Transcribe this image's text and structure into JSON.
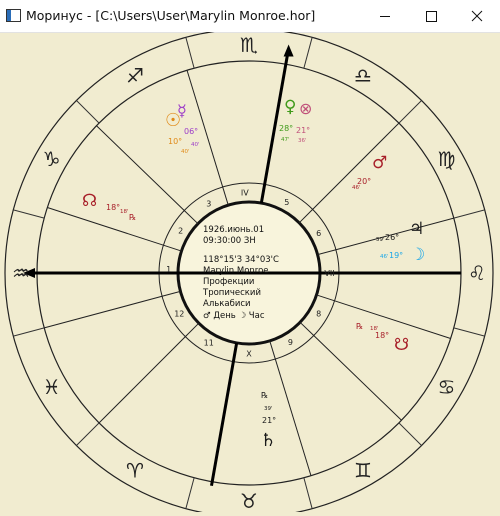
{
  "window": {
    "title": "Моринус - [C:\\Users\\User\\Marylin Monroe.hor]"
  },
  "chart": {
    "center_info": {
      "date": "1926.июнь.01",
      "time": "09:30:00 ЗН",
      "coords": "118°15'З  34°03'С",
      "name": "Marylin Monroe",
      "mode": "Профекции",
      "zodiac": "Тропический",
      "house_system": "Алькабиси",
      "day_ruler": "♂ День ☽ Час"
    },
    "signs": [
      {
        "name": "leo-sign-icon",
        "glyph": "♌"
      },
      {
        "name": "virgo-sign-icon",
        "glyph": "♍"
      },
      {
        "name": "libra-sign-icon",
        "glyph": "♎"
      },
      {
        "name": "scorpio-sign-icon",
        "glyph": "♏"
      },
      {
        "name": "sagittarius-sign-icon",
        "glyph": "♐"
      },
      {
        "name": "capricorn-sign-icon",
        "glyph": "♑"
      },
      {
        "name": "aquarius-sign-icon",
        "glyph": "♒"
      },
      {
        "name": "pisces-sign-icon",
        "glyph": "♓"
      },
      {
        "name": "aries-sign-icon",
        "glyph": "♈"
      },
      {
        "name": "taurus-sign-icon",
        "glyph": "♉"
      },
      {
        "name": "gemini-sign-icon",
        "glyph": "♊"
      },
      {
        "name": "cancer-sign-icon",
        "glyph": "♋"
      }
    ],
    "house_numbers": [
      {
        "name": "house-1",
        "label": "1"
      },
      {
        "name": "house-2",
        "label": "2"
      },
      {
        "name": "house-3",
        "label": "3"
      },
      {
        "name": "house-4",
        "label": "IV"
      },
      {
        "name": "house-5",
        "label": "5"
      },
      {
        "name": "house-6",
        "label": "6"
      },
      {
        "name": "house-7",
        "label": "VII"
      },
      {
        "name": "house-8",
        "label": "8"
      },
      {
        "name": "house-9",
        "label": "9"
      },
      {
        "name": "house-10",
        "label": "X"
      },
      {
        "name": "house-11",
        "label": "11"
      },
      {
        "name": "house-12",
        "label": "12"
      }
    ],
    "planets": [
      {
        "name": "sun",
        "glyph": "☉",
        "degree": "10°",
        "minute": "40'",
        "color": "#e08a18"
      },
      {
        "name": "mercury",
        "glyph": "☿",
        "degree": "06°",
        "minute": "40'",
        "color": "#9c3cc8"
      },
      {
        "name": "venus",
        "glyph": "♀",
        "degree": "28°",
        "minute": "47'",
        "color": "#3f9a1a"
      },
      {
        "name": "part-of-fortune",
        "glyph": "⊗",
        "degree": "21°",
        "minute": "36'",
        "color": "#c0507a"
      },
      {
        "name": "mars",
        "glyph": "♂",
        "degree": "20°",
        "minute": "46'",
        "color": "#a8202a"
      },
      {
        "name": "jupiter",
        "glyph": "♃",
        "degree": "26°",
        "minute": "59'",
        "color": "#1a1a1a"
      },
      {
        "name": "moon",
        "glyph": "☽",
        "degree": "19°",
        "minute": "46'",
        "color": "#19a6e8"
      },
      {
        "name": "south-node",
        "glyph": "☋",
        "degree": "18°",
        "minute": "18'",
        "retro": "℞",
        "color": "#a8202a"
      },
      {
        "name": "north-node",
        "glyph": "☊",
        "degree": "18°",
        "minute": "18'",
        "retro": "℞",
        "color": "#a8202a"
      },
      {
        "name": "saturn",
        "glyph": "♄",
        "degree": "21°",
        "minute": "39'",
        "retro": "℞",
        "color": "#1a1a1a"
      }
    ]
  }
}
